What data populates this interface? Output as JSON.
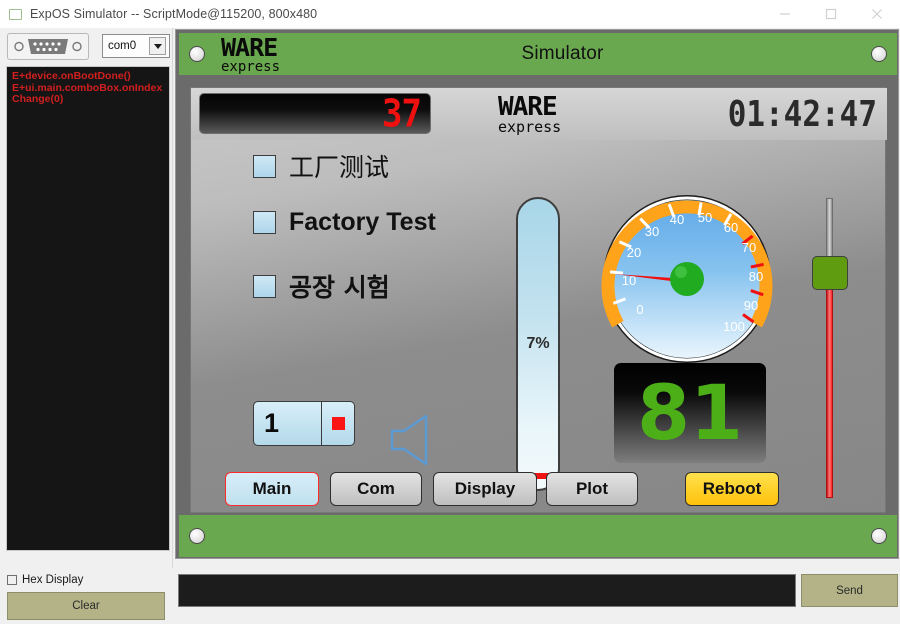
{
  "window": {
    "title": "ExpOS Simulator -- ScriptMode@115200, 800x480",
    "icon": "app-window-icon",
    "controls": {
      "minimize": "minimize-icon",
      "maximize": "maximize-icon",
      "close": "close-icon"
    }
  },
  "left_panel": {
    "serial_icon": "db9-serial-port-icon",
    "port_select": {
      "value": "com0",
      "arrow": "chevron-down-icon"
    },
    "log_lines": [
      "E+device.onBootDone()",
      "E+ui.main.comboBox.onIndexChange(0)"
    ],
    "hex_display": {
      "label": "Hex Display",
      "checked": false
    },
    "clear_button": "Clear"
  },
  "send_bar": {
    "input_value": "",
    "input_placeholder": "",
    "send_button": "Send"
  },
  "device": {
    "brand": {
      "ware": "WARE",
      "express": "express"
    },
    "header_label": "Simulator",
    "screen": {
      "segment_display": "37",
      "clock": "01:42:47",
      "checkboxes": [
        {
          "label": "工厂测试",
          "checked": false,
          "lang": "zh"
        },
        {
          "label": "Factory Test",
          "checked": false,
          "lang": "en"
        },
        {
          "label": "공장 시험",
          "checked": false,
          "lang": "ko"
        }
      ],
      "spinbox": {
        "value": "1",
        "button_icon": "stop-square-icon"
      },
      "speaker_icon": "speaker-icon",
      "progress": {
        "value": "7%",
        "percent": 7
      },
      "gauge": {
        "min": 0,
        "max": 100,
        "value": 16,
        "tick_labels": [
          "0",
          "10",
          "20",
          "30",
          "40",
          "50",
          "60",
          "70",
          "80",
          "90",
          "100"
        ],
        "needle_color": "#f01010",
        "hub_color": "#20ab20",
        "arc_color": "#ffa31a"
      },
      "big_number": {
        "value": "81",
        "color": "#4caf17"
      },
      "slider": {
        "percent": 24,
        "handle_color": "#5f9c10",
        "fill_color": "#ff2222"
      },
      "nav_buttons": [
        {
          "label": "Main",
          "state": "active"
        },
        {
          "label": "Com",
          "state": "normal"
        },
        {
          "label": "Display",
          "state": "normal"
        },
        {
          "label": "Plot",
          "state": "normal"
        }
      ],
      "reboot_button": {
        "label": "Reboot",
        "state": "warn"
      }
    }
  },
  "colors": {
    "bezel_green": "#6aa84f",
    "accent_red": "#d21f1f",
    "khaki": "#b3b387",
    "reboot_yellow": "#ffc20a"
  }
}
